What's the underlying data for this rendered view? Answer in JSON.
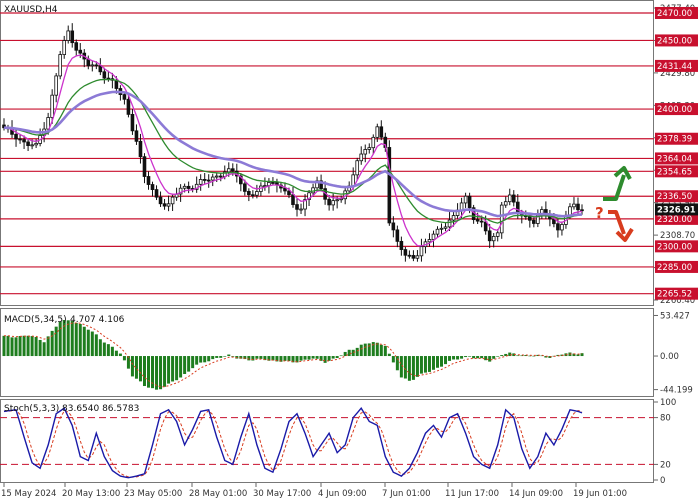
{
  "chart_data": {
    "type": "candlestick",
    "symbol_label": "XAUUSD,H4",
    "x_labels": [
      "15 May 2024",
      "20 May 13:00",
      "23 May 05:00",
      "28 May 01:00",
      "30 May 17:00",
      "4 Jun 09:00",
      "7 Jun 01:00",
      "11 Jun 17:00",
      "14 Jun 09:00",
      "19 Jun 01:00"
    ],
    "price_axis": {
      "ylim": [
        2258,
        2478
      ],
      "ticks": [
        "2477.40",
        "2453.60",
        "2429.80",
        "2405.30",
        "2381.50",
        "2357.70",
        "2333.90",
        "2308.70",
        "2284.90",
        "2260.40"
      ]
    },
    "levels": [
      {
        "value": 2470.0,
        "label": "2470.00"
      },
      {
        "value": 2450.0,
        "label": "2450.00"
      },
      {
        "value": 2431.44,
        "label": "2431.44"
      },
      {
        "value": 2400.0,
        "label": "2400.00"
      },
      {
        "value": 2378.39,
        "label": "2378.39"
      },
      {
        "value": 2364.04,
        "label": "2364.04"
      },
      {
        "value": 2354.65,
        "label": "2354.65"
      },
      {
        "value": 2336.5,
        "label": "2336.50"
      },
      {
        "value": 2320.0,
        "label": "2320.00"
      },
      {
        "value": 2300.0,
        "label": "2300.00"
      },
      {
        "value": 2285.0,
        "label": "2285.00"
      },
      {
        "value": 2265.52,
        "label": "2265.52"
      }
    ],
    "current_price": {
      "value": 2326.91,
      "label": "2326.91"
    },
    "price_keypoints": [
      [
        0,
        2385
      ],
      [
        4,
        2378
      ],
      [
        8,
        2372
      ],
      [
        11,
        2395
      ],
      [
        14,
        2440
      ],
      [
        16,
        2455
      ],
      [
        18,
        2445
      ],
      [
        21,
        2432
      ],
      [
        24,
        2428
      ],
      [
        27,
        2420
      ],
      [
        30,
        2405
      ],
      [
        33,
        2378
      ],
      [
        35,
        2350
      ],
      [
        38,
        2335
      ],
      [
        41,
        2330
      ],
      [
        44,
        2342
      ],
      [
        48,
        2345
      ],
      [
        52,
        2350
      ],
      [
        55,
        2355
      ],
      [
        58,
        2352
      ],
      [
        60,
        2340
      ],
      [
        63,
        2338
      ],
      [
        66,
        2348
      ],
      [
        69,
        2344
      ],
      [
        72,
        2330
      ],
      [
        74,
        2328
      ],
      [
        76,
        2340
      ],
      [
        78,
        2345
      ],
      [
        81,
        2332
      ],
      [
        84,
        2335
      ],
      [
        86,
        2342
      ],
      [
        88,
        2365
      ],
      [
        91,
        2372
      ],
      [
        93,
        2385
      ],
      [
        95,
        2375
      ],
      [
        96,
        2318
      ],
      [
        98,
        2303
      ],
      [
        100,
        2292
      ],
      [
        103,
        2295
      ],
      [
        106,
        2305
      ],
      [
        109,
        2315
      ],
      [
        112,
        2320
      ],
      [
        114,
        2332
      ],
      [
        115,
        2336
      ],
      [
        117,
        2322
      ],
      [
        119,
        2315
      ],
      [
        121,
        2305
      ],
      [
        123,
        2310
      ],
      [
        124,
        2332
      ],
      [
        126,
        2335
      ],
      [
        128,
        2325
      ],
      [
        130,
        2322
      ],
      [
        132,
        2318
      ],
      [
        134,
        2324
      ],
      [
        136,
        2322
      ],
      [
        138,
        2312
      ],
      [
        140,
        2322
      ],
      [
        142,
        2330
      ],
      [
        144,
        2328
      ]
    ],
    "overlay_lines": [
      {
        "color": "#cc33cc",
        "role": "fast"
      },
      {
        "color": "#2e8b2e",
        "role": "medium"
      },
      {
        "color": "#8c7ad6",
        "role": "slow"
      }
    ],
    "forecast_arrows": [
      {
        "direction": "up",
        "color": "#2e8b2e"
      },
      {
        "direction": "down",
        "color": "#d83c1e"
      }
    ],
    "forecast_mark": "?",
    "macd": {
      "label": "MACD(5,34,5)",
      "values_label": "4.707 4.106",
      "ticks": [
        "53.427",
        "0.00",
        "-44.199"
      ],
      "ylim": [
        -50,
        58
      ],
      "keypoints": [
        [
          0,
          25
        ],
        [
          6,
          27
        ],
        [
          10,
          20
        ],
        [
          14,
          45
        ],
        [
          17,
          48
        ],
        [
          20,
          38
        ],
        [
          23,
          28
        ],
        [
          26,
          15
        ],
        [
          29,
          3
        ],
        [
          32,
          -25
        ],
        [
          35,
          -40
        ],
        [
          38,
          -44
        ],
        [
          41,
          -38
        ],
        [
          44,
          -28
        ],
        [
          47,
          -15
        ],
        [
          50,
          -8
        ],
        [
          53,
          -2
        ],
        [
          56,
          0
        ],
        [
          59,
          -3
        ],
        [
          62,
          -6
        ],
        [
          65,
          -4
        ],
        [
          68,
          -7
        ],
        [
          71,
          -8
        ],
        [
          74,
          -6
        ],
        [
          77,
          -4
        ],
        [
          80,
          -7
        ],
        [
          83,
          -3
        ],
        [
          86,
          8
        ],
        [
          89,
          14
        ],
        [
          92,
          18
        ],
        [
          95,
          15
        ],
        [
          97,
          -10
        ],
        [
          99,
          -28
        ],
        [
          101,
          -32
        ],
        [
          104,
          -25
        ],
        [
          107,
          -18
        ],
        [
          110,
          -10
        ],
        [
          113,
          -4
        ],
        [
          116,
          0
        ],
        [
          118,
          -4
        ],
        [
          121,
          -6
        ],
        [
          124,
          2
        ],
        [
          127,
          3
        ],
        [
          130,
          1
        ],
        [
          133,
          0
        ],
        [
          136,
          -1
        ],
        [
          139,
          2
        ],
        [
          142,
          4
        ],
        [
          144,
          4
        ]
      ]
    },
    "stochastic": {
      "label": "Stoch(5,3,3)",
      "values_label": "83.6540 86.5783",
      "ticks": [
        "100",
        "80",
        "20",
        "0"
      ],
      "ylim": [
        0,
        100
      ],
      "levels": [
        80,
        20
      ],
      "keypoints": [
        [
          0,
          88
        ],
        [
          3,
          90
        ],
        [
          5,
          55
        ],
        [
          7,
          22
        ],
        [
          9,
          15
        ],
        [
          11,
          45
        ],
        [
          13,
          85
        ],
        [
          15,
          92
        ],
        [
          17,
          70
        ],
        [
          19,
          30
        ],
        [
          21,
          25
        ],
        [
          23,
          60
        ],
        [
          25,
          30
        ],
        [
          27,
          12
        ],
        [
          29,
          5
        ],
        [
          31,
          3
        ],
        [
          33,
          5
        ],
        [
          35,
          8
        ],
        [
          37,
          45
        ],
        [
          39,
          85
        ],
        [
          41,
          90
        ],
        [
          43,
          75
        ],
        [
          45,
          45
        ],
        [
          47,
          65
        ],
        [
          49,
          88
        ],
        [
          51,
          90
        ],
        [
          53,
          55
        ],
        [
          55,
          25
        ],
        [
          57,
          20
        ],
        [
          59,
          55
        ],
        [
          61,
          85
        ],
        [
          63,
          45
        ],
        [
          65,
          15
        ],
        [
          67,
          10
        ],
        [
          69,
          40
        ],
        [
          71,
          75
        ],
        [
          73,
          85
        ],
        [
          75,
          60
        ],
        [
          77,
          30
        ],
        [
          79,
          45
        ],
        [
          81,
          60
        ],
        [
          83,
          35
        ],
        [
          85,
          45
        ],
        [
          87,
          80
        ],
        [
          89,
          92
        ],
        [
          91,
          75
        ],
        [
          93,
          70
        ],
        [
          95,
          30
        ],
        [
          97,
          10
        ],
        [
          99,
          5
        ],
        [
          101,
          15
        ],
        [
          103,
          35
        ],
        [
          105,
          60
        ],
        [
          107,
          70
        ],
        [
          109,
          55
        ],
        [
          111,
          80
        ],
        [
          113,
          85
        ],
        [
          115,
          60
        ],
        [
          117,
          30
        ],
        [
          119,
          20
        ],
        [
          121,
          15
        ],
        [
          123,
          45
        ],
        [
          125,
          90
        ],
        [
          127,
          80
        ],
        [
          129,
          40
        ],
        [
          131,
          15
        ],
        [
          133,
          30
        ],
        [
          135,
          60
        ],
        [
          137,
          45
        ],
        [
          139,
          65
        ],
        [
          141,
          90
        ],
        [
          143,
          88
        ],
        [
          144,
          86
        ]
      ]
    }
  }
}
